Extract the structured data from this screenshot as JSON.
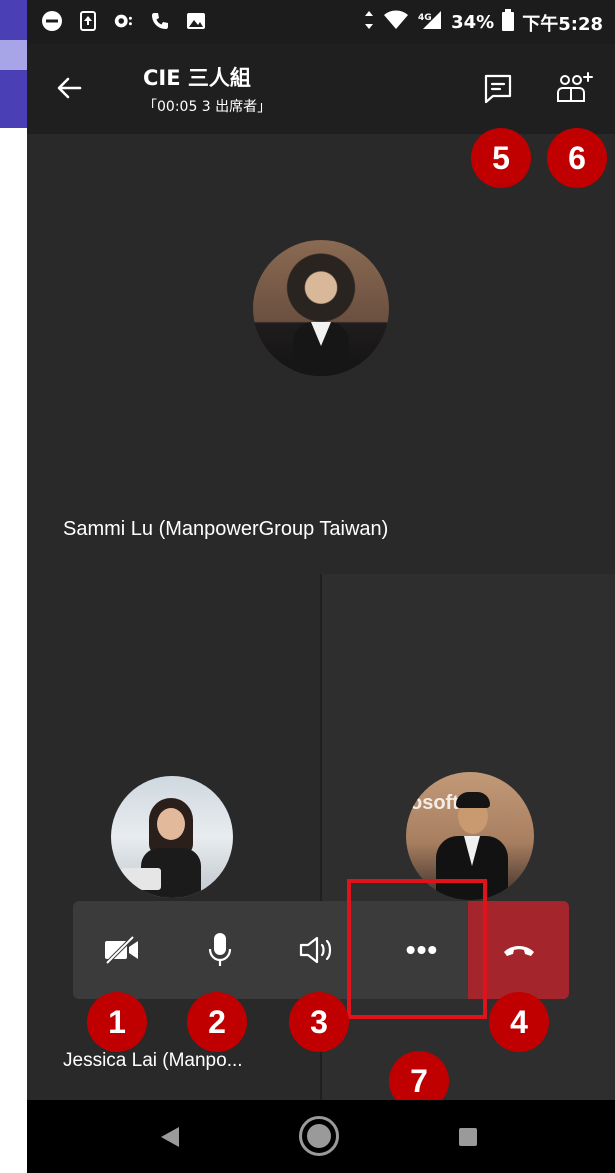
{
  "status_bar": {
    "battery": "34%",
    "time": "下午5:28",
    "icons_left": [
      "dnd-icon",
      "upload-icon",
      "voicemail-icon",
      "phone-icon",
      "image-icon"
    ],
    "icons_right": [
      "vibrate-icon",
      "wifi-icon",
      "signal-icon",
      "battery-icon"
    ]
  },
  "header": {
    "title": "CIE 三人組",
    "subtitle": "「00:05 3 出席者」",
    "back_icon": "arrow-left-icon",
    "chat_icon": "chat-icon",
    "participants_icon": "add-people-icon"
  },
  "participants": {
    "top": {
      "name": "Sammi Lu (ManpowerGroup Taiwan)"
    },
    "bottom_left": {
      "name": "Jessica Lai (Manpo..."
    },
    "bottom_right": {
      "logo_text": "osoft"
    }
  },
  "controls": {
    "video": "camera-off-icon",
    "mic": "microphone-icon",
    "speaker": "speaker-icon",
    "more": "•••",
    "hangup": "hang-up-icon",
    "hangup_color": "#a4262c"
  },
  "badges": [
    "1",
    "2",
    "3",
    "4",
    "5",
    "6",
    "7"
  ],
  "colors": {
    "badge": "#c00000",
    "highlight": "#e0121a",
    "background": "#292929"
  }
}
